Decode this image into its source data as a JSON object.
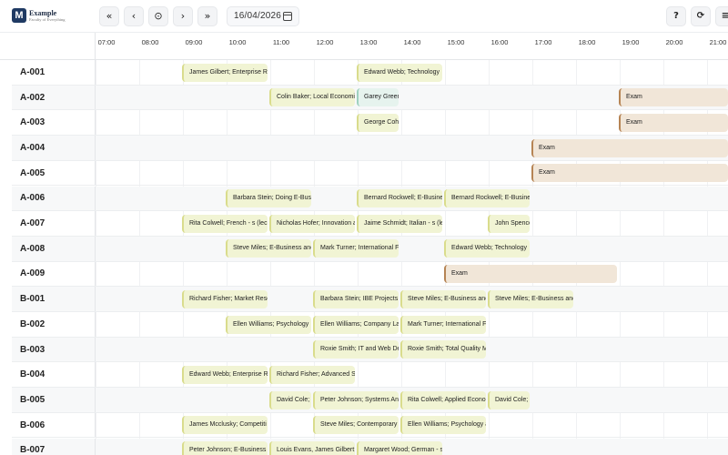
{
  "app": {
    "logo_letter": "M",
    "title": "Example",
    "subtitle": "Faculty of Everything"
  },
  "toolbar": {
    "first_icon": "«",
    "prev_icon": "‹",
    "today_icon": "⊙",
    "next_icon": "›",
    "last_icon": "»",
    "date": "16/04/2026",
    "help_icon": "?",
    "refresh_icon": "⟳",
    "menu_icon": "≡"
  },
  "timeline": {
    "hours": [
      "07:00",
      "08:00",
      "09:00",
      "10:00",
      "11:00",
      "12:00",
      "13:00",
      "14:00",
      "15:00",
      "16:00",
      "17:00",
      "18:00",
      "19:00",
      "20:00",
      "21:00"
    ]
  },
  "rooms": [
    {
      "name": "A-001",
      "events": [
        {
          "title": "James Gilbert; Enterprise Re",
          "start": 8.0,
          "end": 10.0,
          "kind": "course"
        },
        {
          "title": "Edward Webb; Technology",
          "start": 12.0,
          "end": 14.0,
          "kind": "course"
        }
      ]
    },
    {
      "name": "A-002",
      "events": [
        {
          "title": "Colin Baker; Local Economic",
          "start": 10.0,
          "end": 12.0,
          "kind": "course"
        },
        {
          "title": "Garey Greene",
          "start": 12.0,
          "end": 13.0,
          "kind": "green"
        },
        {
          "title": "Exam",
          "start": 18.0,
          "end": 21.6,
          "kind": "exam"
        }
      ]
    },
    {
      "name": "A-003",
      "events": [
        {
          "title": "George Cohe",
          "start": 12.0,
          "end": 13.0,
          "kind": "course"
        },
        {
          "title": "Exam",
          "start": 18.0,
          "end": 21.6,
          "kind": "exam"
        }
      ]
    },
    {
      "name": "A-004",
      "events": [
        {
          "title": "Exam",
          "start": 16.0,
          "end": 21.6,
          "kind": "exam"
        }
      ]
    },
    {
      "name": "A-005",
      "events": [
        {
          "title": "Exam",
          "start": 16.0,
          "end": 21.6,
          "kind": "exam"
        }
      ]
    },
    {
      "name": "A-006",
      "events": [
        {
          "title": "Barbara Stein; Doing E-Busi",
          "start": 9.0,
          "end": 11.0,
          "kind": "course"
        },
        {
          "title": "Bernard Rockwell; E-Busine",
          "start": 12.0,
          "end": 14.0,
          "kind": "course"
        },
        {
          "title": "Bernard Rockwell; E-Busine",
          "start": 14.0,
          "end": 16.0,
          "kind": "course"
        }
      ]
    },
    {
      "name": "A-007",
      "events": [
        {
          "title": "Rita Colwell; French - s (lec",
          "start": 8.0,
          "end": 10.0,
          "kind": "course"
        },
        {
          "title": "Nicholas Hofer; Innovation a",
          "start": 10.0,
          "end": 12.0,
          "kind": "course"
        },
        {
          "title": "Jaime Schmidt; Italian - s (le",
          "start": 12.0,
          "end": 14.0,
          "kind": "course"
        },
        {
          "title": "John Spence",
          "start": 15.0,
          "end": 16.0,
          "kind": "course"
        }
      ]
    },
    {
      "name": "A-008",
      "events": [
        {
          "title": "Steve Miles; E-Business and",
          "start": 9.0,
          "end": 11.0,
          "kind": "course"
        },
        {
          "title": "Mark Turner; International F",
          "start": 11.0,
          "end": 13.0,
          "kind": "course"
        },
        {
          "title": "Edward Webb; Technology",
          "start": 14.0,
          "end": 16.0,
          "kind": "course"
        }
      ]
    },
    {
      "name": "A-009",
      "events": [
        {
          "title": "Exam",
          "start": 14.0,
          "end": 18.0,
          "kind": "exam"
        }
      ]
    },
    {
      "name": "B-001",
      "events": [
        {
          "title": "Richard Fisher; Market Rese",
          "start": 8.0,
          "end": 10.0,
          "kind": "course"
        },
        {
          "title": "Barbara Stein; IBE Projects",
          "start": 11.0,
          "end": 13.0,
          "kind": "course"
        },
        {
          "title": "Steve Miles; E-Business and",
          "start": 13.0,
          "end": 15.0,
          "kind": "course"
        },
        {
          "title": "Steve Miles; E-Business and",
          "start": 15.0,
          "end": 17.0,
          "kind": "course"
        }
      ]
    },
    {
      "name": "B-002",
      "events": [
        {
          "title": "Ellen Williams; Psychology",
          "start": 9.0,
          "end": 11.0,
          "kind": "course"
        },
        {
          "title": "Ellen Williams; Company La",
          "start": 11.0,
          "end": 13.0,
          "kind": "course"
        },
        {
          "title": "Mark Turner; International F",
          "start": 13.0,
          "end": 15.0,
          "kind": "course"
        }
      ]
    },
    {
      "name": "B-003",
      "events": [
        {
          "title": "Roxie Smith; IT and Web De",
          "start": 11.0,
          "end": 13.0,
          "kind": "course"
        },
        {
          "title": "Roxie Smith; Total Quality M",
          "start": 13.0,
          "end": 15.0,
          "kind": "course"
        }
      ]
    },
    {
      "name": "B-004",
      "events": [
        {
          "title": "Edward Webb; Enterprise Re",
          "start": 8.0,
          "end": 10.0,
          "kind": "course"
        },
        {
          "title": "Richard Fisher; Advanced S",
          "start": 10.0,
          "end": 12.0,
          "kind": "course"
        }
      ]
    },
    {
      "name": "B-005",
      "events": [
        {
          "title": "David Cole; F",
          "start": 10.0,
          "end": 11.0,
          "kind": "course"
        },
        {
          "title": "Peter Johnson; Systems An",
          "start": 11.0,
          "end": 13.0,
          "kind": "course"
        },
        {
          "title": "Rita Colwell; Applied Econo",
          "start": 13.0,
          "end": 15.0,
          "kind": "course"
        },
        {
          "title": "David Cole; F",
          "start": 15.0,
          "end": 16.0,
          "kind": "course"
        }
      ]
    },
    {
      "name": "B-006",
      "events": [
        {
          "title": "James Mcclusky; Competiti",
          "start": 8.0,
          "end": 10.0,
          "kind": "course"
        },
        {
          "title": "Steve Miles; Contemporary",
          "start": 11.0,
          "end": 13.0,
          "kind": "course"
        },
        {
          "title": "Ellen Williams; Psychology a",
          "start": 13.0,
          "end": 15.0,
          "kind": "course"
        }
      ]
    },
    {
      "name": "B-007",
      "events": [
        {
          "title": "Peter Johnson; E-Business",
          "start": 8.0,
          "end": 10.0,
          "kind": "course"
        },
        {
          "title": "Louis Evans, James Gilbert;",
          "start": 10.0,
          "end": 12.0,
          "kind": "course"
        },
        {
          "title": "Margaret Wood; German - s",
          "start": 12.0,
          "end": 14.0,
          "kind": "course"
        }
      ]
    }
  ]
}
